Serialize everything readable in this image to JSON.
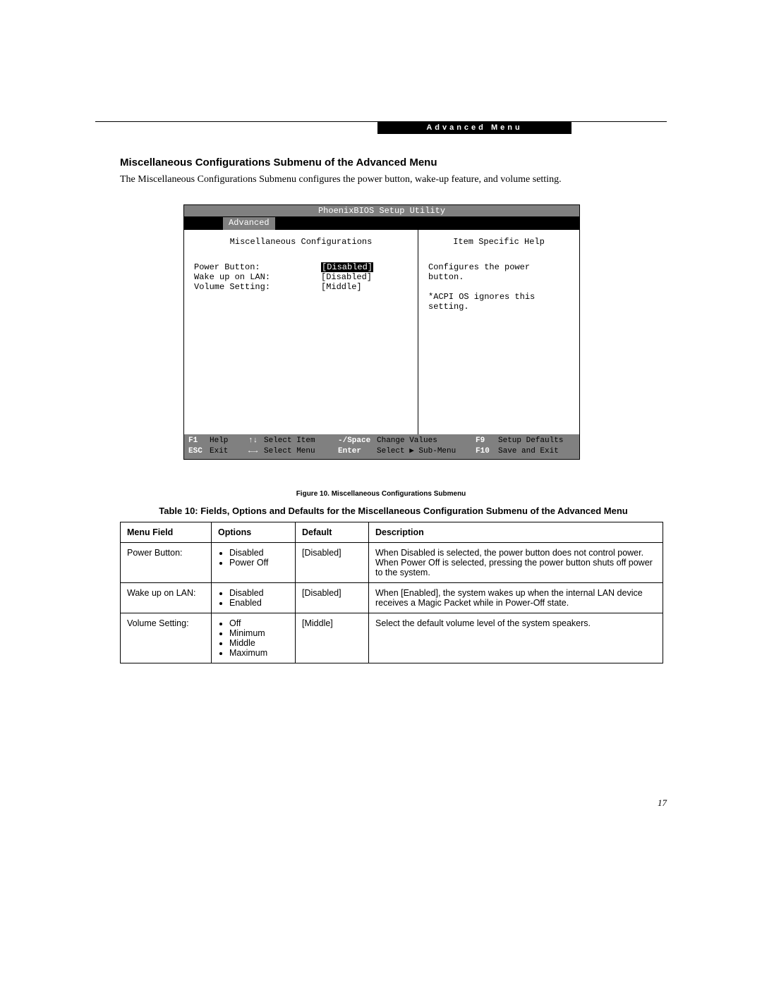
{
  "header_badge": "Advanced Menu",
  "title": "Miscellaneous Configurations Submenu of the Advanced Menu",
  "intro": "The Miscellaneous Configurations Submenu configures the power button, wake-up feature, and volume setting.",
  "bios": {
    "title": "PhoenixBIOS Setup Utility",
    "tab": "Advanced",
    "left_title": "Miscellaneous Configurations",
    "right_title": "Item Specific Help",
    "rows": [
      {
        "label": "Power Button:",
        "value": "[Disabled]",
        "selected": true
      },
      {
        "label": "Wake up on LAN:",
        "value": "[Disabled]",
        "selected": false
      },
      {
        "label": "Volume Setting:",
        "value": "[Middle]",
        "selected": false
      }
    ],
    "help": "Configures the power button.\n\n*ACPI OS ignores this setting.",
    "footer": {
      "r1": {
        "k1": "F1",
        "v1": "Help",
        "arr1": "↑↓",
        "v2": "Select Item",
        "k2": "-/Space",
        "v3": "Change Values",
        "k3": "F9",
        "v4": "Setup Defaults"
      },
      "r2": {
        "k1": "ESC",
        "v1": "Exit",
        "arr1": "←→",
        "v2": "Select Menu",
        "k2": "Enter",
        "v3": "Select ▶ Sub-Menu",
        "k3": "F10",
        "v4": "Save and Exit"
      }
    }
  },
  "figure_caption": "Figure 10.  Miscellaneous Configurations Submenu",
  "table_title": "Table 10: Fields, Options and Defaults for the Miscellaneous Configuration Submenu of the Advanced Menu",
  "table": {
    "headers": [
      "Menu Field",
      "Options",
      "Default",
      "Description"
    ],
    "rows": [
      {
        "field": "Power Button:",
        "options": [
          "Disabled",
          "Power Off"
        ],
        "default": "[Disabled]",
        "desc": "When Disabled is selected, the power button does not control power. When Power Off is selected, pressing the power button shuts off power to the system."
      },
      {
        "field": "Wake up on LAN:",
        "options": [
          "Disabled",
          "Enabled"
        ],
        "default": "[Disabled]",
        "desc": "When [Enabled], the system wakes up when the internal LAN device receives a Magic Packet while in Power-Off state."
      },
      {
        "field": "Volume Setting:",
        "options": [
          "Off",
          "Minimum",
          "Middle",
          "Maximum"
        ],
        "default": "[Middle]",
        "desc": "Select the default volume level of the system speakers."
      }
    ]
  },
  "page_number": "17"
}
